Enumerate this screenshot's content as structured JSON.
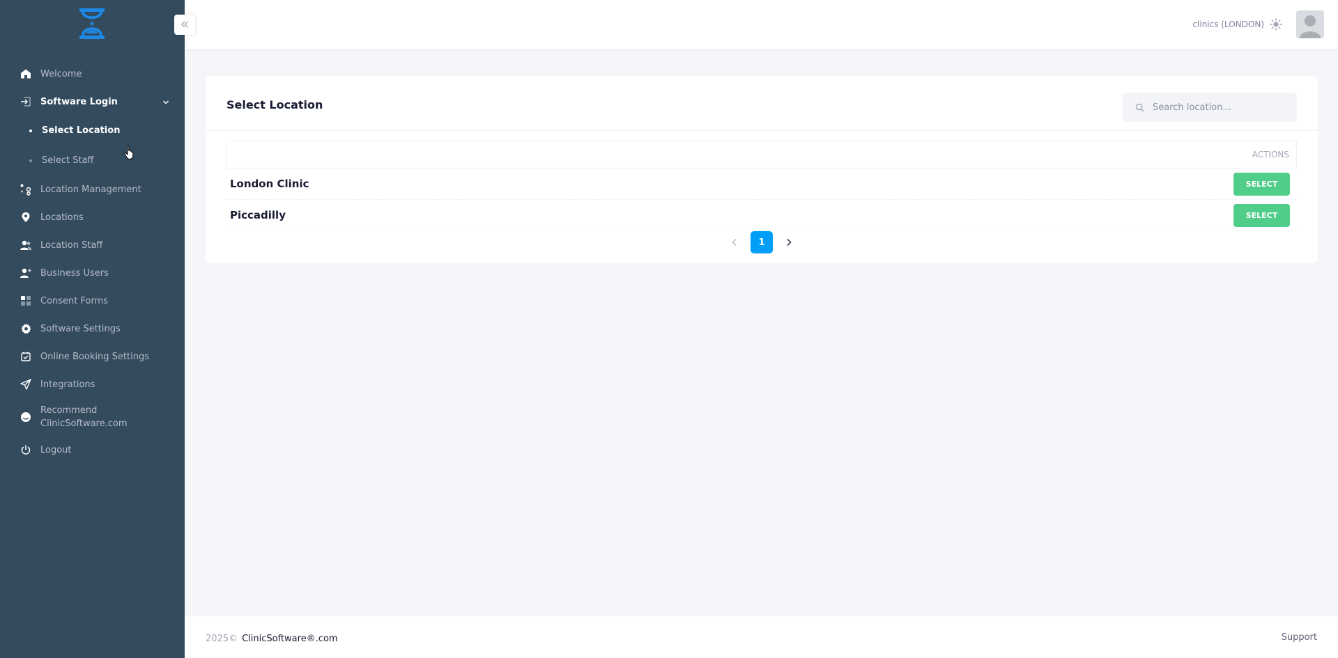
{
  "sidebar": {
    "items": [
      {
        "label": "Welcome",
        "icon": "home-icon"
      },
      {
        "label": "Software Login",
        "icon": "login-icon"
      },
      {
        "label": "Location Management",
        "icon": "location-management-icon"
      },
      {
        "label": "Locations",
        "icon": "map-pin-icon"
      },
      {
        "label": "Location Staff",
        "icon": "users-icon"
      },
      {
        "label": "Business Users",
        "icon": "user-plus-icon"
      },
      {
        "label": "Consent Forms",
        "icon": "grid-icon"
      },
      {
        "label": "Software Settings",
        "icon": "gear-icon"
      },
      {
        "label": "Online Booking Settings",
        "icon": "calendar-check-icon"
      },
      {
        "label": "Integrations",
        "icon": "send-icon"
      },
      {
        "label": "Recommend ClinicSoftware.com",
        "icon": "smile-icon"
      },
      {
        "label": "Logout",
        "icon": "power-icon"
      }
    ],
    "sub_items": [
      {
        "label": "Select Location"
      },
      {
        "label": "Select Staff"
      }
    ]
  },
  "header": {
    "location": "clinics (LONDON)"
  },
  "card": {
    "title": "Select Location",
    "search_placeholder": "Search location...",
    "actions_header": "ACTIONS",
    "rows": [
      {
        "name": "London Clinic",
        "button": "SELECT"
      },
      {
        "name": "Piccadilly",
        "button": "SELECT"
      }
    ],
    "current_page": "1"
  },
  "footer": {
    "year": "2025©",
    "brand": "ClinicSoftware®.com",
    "support": "Support"
  },
  "colors": {
    "sidebar_bg": "#344b5e",
    "primary": "#009ef7",
    "success": "#50cd89",
    "logo": "#1e88e5"
  }
}
